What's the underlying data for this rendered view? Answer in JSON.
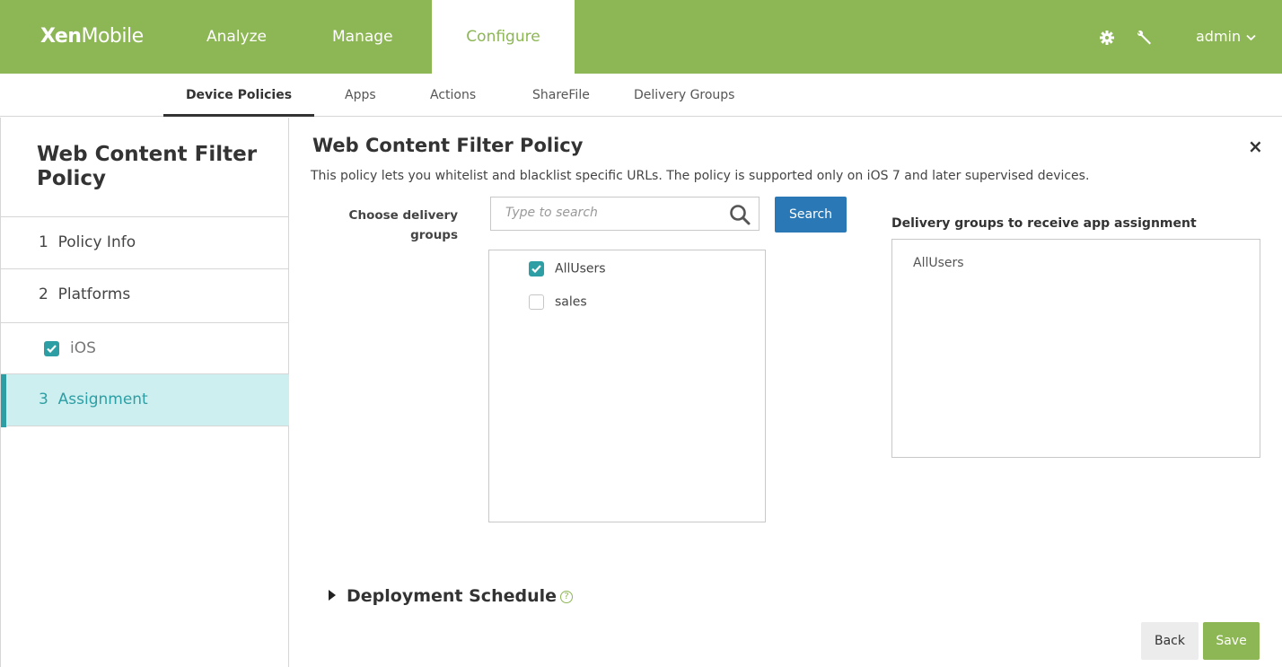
{
  "app": {
    "logo_bold": "Xen",
    "logo_light": "Mobile"
  },
  "topnav": {
    "items": [
      {
        "label": "Analyze"
      },
      {
        "label": "Manage"
      },
      {
        "label": "Configure",
        "active": true
      }
    ],
    "user": "admin"
  },
  "subnav": {
    "items": [
      {
        "label": "Device Policies",
        "active": true
      },
      {
        "label": "Apps"
      },
      {
        "label": "Actions"
      },
      {
        "label": "ShareFile"
      },
      {
        "label": "Delivery Groups"
      }
    ]
  },
  "sidebar": {
    "title": "Web Content Filter Policy",
    "items": [
      {
        "label": "1  Policy Info"
      },
      {
        "label": "2  Platforms"
      },
      {
        "label": "iOS",
        "checked": true
      },
      {
        "label": "3  Assignment",
        "active": true
      }
    ]
  },
  "main": {
    "title": "Web Content Filter Policy",
    "description": "This policy lets you whitelist and blacklist specific URLs. The policy is supported only on iOS 7 and later supervised devices.",
    "choose_label_line1": "Choose delivery",
    "choose_label_line2": "groups",
    "search": {
      "placeholder": "Type to search",
      "value": "",
      "button_label": "Search"
    },
    "groups": [
      {
        "label": "AllUsers",
        "checked": true
      },
      {
        "label": "sales",
        "checked": false
      }
    ],
    "receive_label": "Delivery groups to receive app assignment",
    "receive_items": [
      "AllUsers"
    ],
    "deployment_schedule": "Deployment Schedule",
    "help_glyph": "?",
    "back_label": "Back",
    "save_label": "Save",
    "close_glyph": "×"
  },
  "colors": {
    "brand_green": "#8db654",
    "teal": "#2d9fa4",
    "button_blue": "#2a78b5"
  }
}
